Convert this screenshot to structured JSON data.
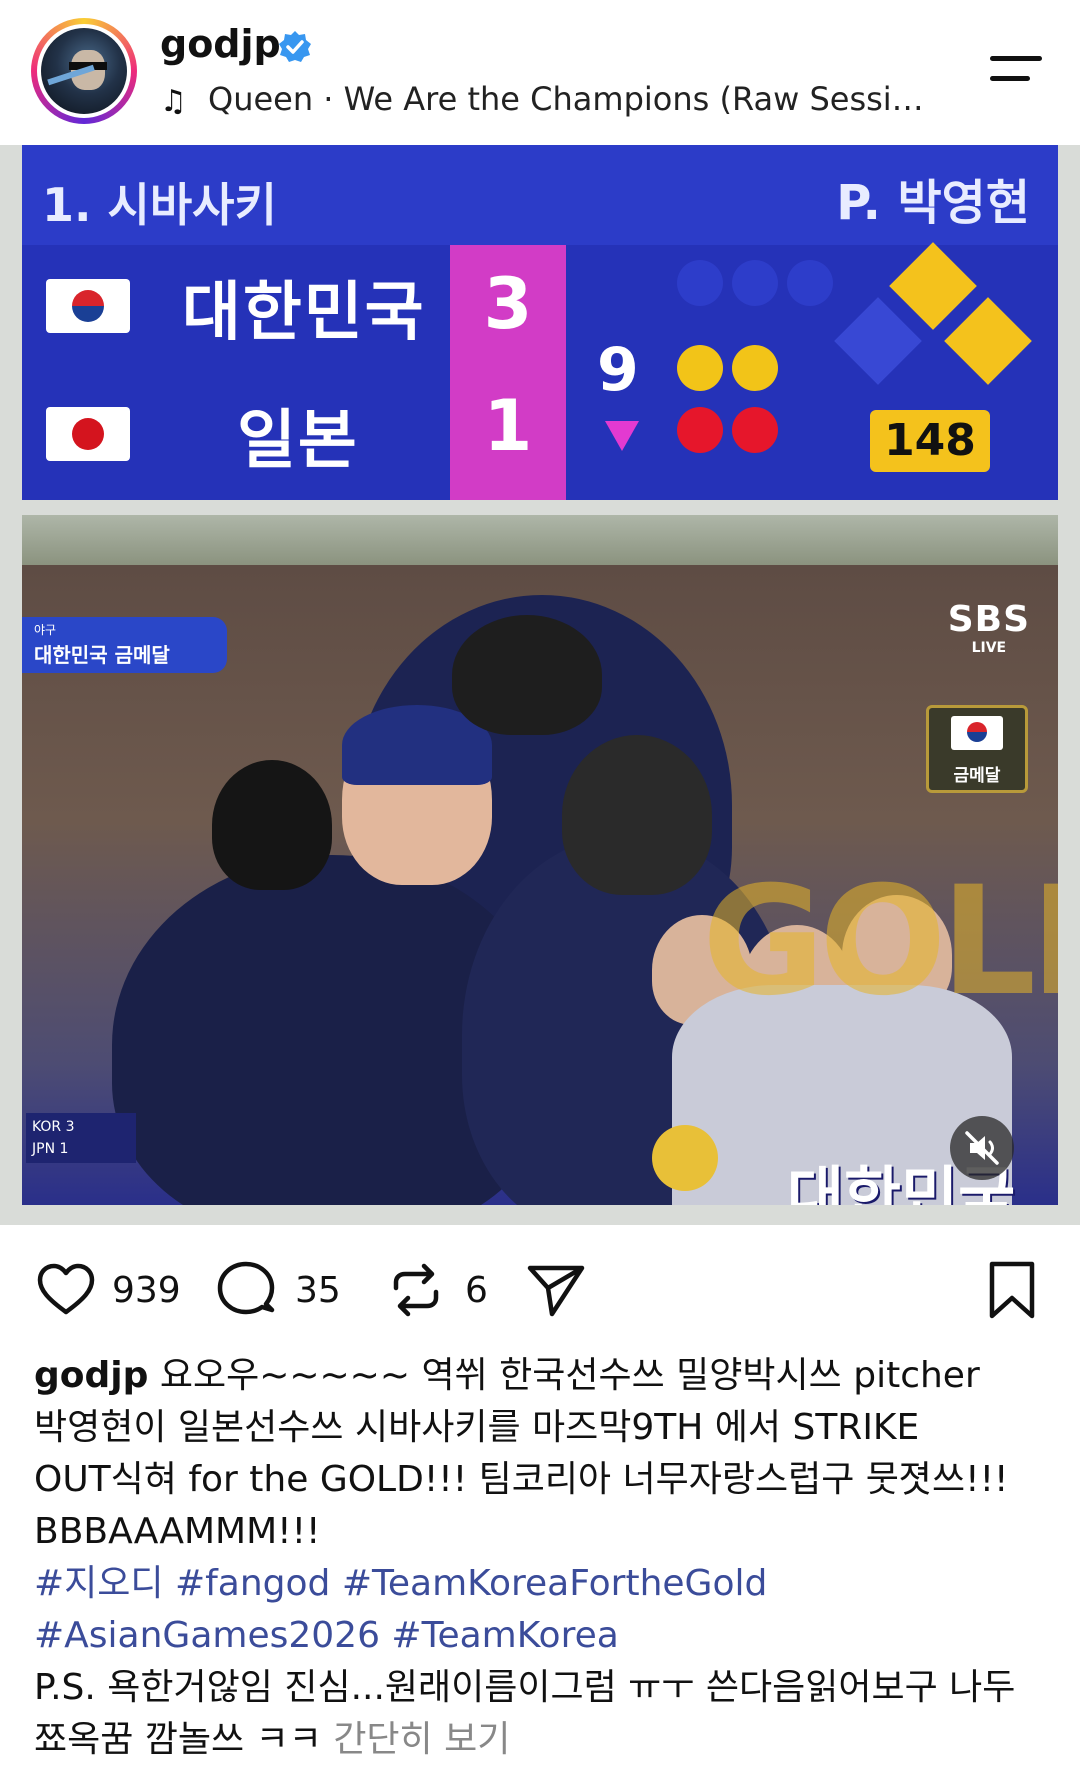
{
  "header": {
    "username": "godjp",
    "music_text": "Queen · We Are the Champions (Raw Sessio..."
  },
  "scoreboard": {
    "batter": "1. 시바사키",
    "pitcher": "P. 박영현",
    "home_team": "대한민국",
    "away_team": "일본",
    "home_score": "3",
    "away_score": "1",
    "inning": "9",
    "pitch_speed": "148"
  },
  "broadcast": {
    "badge_small": "야구",
    "badge_big": "대한민국 금메달",
    "channel_logo": "SBS",
    "channel_live": "LIVE",
    "medal_label": "금메달",
    "mini_row1": "KOR 3",
    "mini_row2": "JPN 1",
    "gold_word": "GOLD",
    "country_word": "대한민국"
  },
  "actions": {
    "likes": "939",
    "comments": "35",
    "reposts": "6"
  },
  "caption": {
    "username": "godjp",
    "text_line1": " 요오우~~~~~ 역쒸 한국선수쓰 밀양박시쓰 pitcher",
    "text_line2": "박영현이 일본선수쓰 시바사키를 마즈막9TH 에서 STRIKE",
    "text_line3": "OUT식혀 for the GOLD!!! 팀코리아 너무자랑스럽구 뭇졋쓰!!!",
    "text_line4": "BBBAAAMMM!!!",
    "tags_line1": "#지오디 #fangod #TeamKoreaFortheGold",
    "tags_line2": "#AsianGames2026 #TeamKorea",
    "ps_line1": "P.S. 욕한거않임 진심...원래이름이그럼 ㅠㅜ 쓴다음읽어보구 나두",
    "ps_line2": "쬬옥꿈 깜놀쓰 ㅋㅋ",
    "more_label": "간단히 보기"
  },
  "colors": {
    "scoreboard_blue": "#2532b8",
    "score_magenta": "#d23cc6",
    "hashtag": "#3b4c9a",
    "verified": "#3897f0"
  }
}
